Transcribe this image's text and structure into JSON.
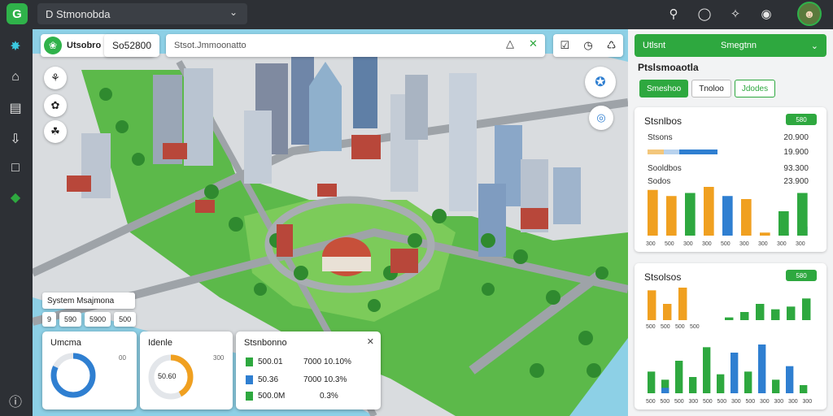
{
  "topbar": {
    "logo": "G",
    "title": "D  Stmonobda",
    "icons": [
      "search-icon",
      "circle-icon",
      "tools-icon",
      "notification-icon"
    ]
  },
  "sidebar": {
    "icons": [
      "network-icon",
      "home-icon",
      "clipboard-icon",
      "download-icon",
      "square-icon",
      "layers-icon",
      "help-icon"
    ]
  },
  "map": {
    "toolbar_label": "Utsobro",
    "score": "So52800",
    "search_placeholder": "Stsot.Jmmoonatto",
    "actions": [
      "clipboard-icon",
      "clock-icon",
      "share-icon"
    ],
    "tools": [
      "bike-icon",
      "tree-icon",
      "plant-icon"
    ],
    "system_label": "System Msajmona",
    "system_chips": [
      "9",
      "590",
      "5900",
      "500"
    ],
    "card1": {
      "title": "Umcma",
      "aside": "00",
      "progress": 0.82
    },
    "card2": {
      "title": "Idenle",
      "aside": "300",
      "center": "50.60",
      "progress": 0.42
    },
    "card3": {
      "title": "Stsnbonno",
      "rows": [
        {
          "color": "#2ea83f",
          "label": "500.01",
          "value": "7000 10.10%"
        },
        {
          "color": "#2f7fd1",
          "label": "50.36",
          "value": "7000 10.3%"
        },
        {
          "color": "#2ea83f",
          "label": "500.0M",
          "value": "0.3%"
        }
      ]
    },
    "colors": {
      "green": "#2ea83f",
      "blue": "#2f7fd1",
      "orange": "#f0a020"
    }
  },
  "right_panel": {
    "header_a": "Utlsnt",
    "header_b": "Smegtnn",
    "subtitle": "Ptslsmoaotla",
    "tabs": [
      "Smeshoo",
      "Tnoloo",
      "Jdodes"
    ],
    "stats1": {
      "title": "Stsnlbos",
      "badge": "580",
      "rows": [
        {
          "label": "Stsons",
          "value": "20.900"
        },
        {
          "label": "",
          "value": "19.900"
        },
        {
          "label": "Sooldbos",
          "value": "93.300"
        },
        {
          "label": "Sodos",
          "value": "23.900"
        }
      ],
      "mini_bars": [
        0.6,
        0.55,
        0.8,
        0.6,
        0.4
      ],
      "legend": [
        "300",
        "500",
        "300",
        "300",
        "500",
        "300",
        "300",
        "300",
        "300"
      ]
    },
    "stats2": {
      "title": "Stsolsos",
      "badge": "580",
      "legend": [
        "500",
        "500",
        "500",
        "500"
      ],
      "legend_bottom": [
        "500",
        "500",
        "500",
        "300",
        "500",
        "500",
        "300",
        "500",
        "300",
        "300",
        "300",
        "300"
      ]
    }
  },
  "chart_data": [
    {
      "type": "bar",
      "categories": [
        "300",
        "500",
        "300",
        "300",
        "500",
        "300",
        "300",
        "300",
        "300"
      ],
      "series": [
        {
          "values": [
            75,
            65,
            0,
            80,
            0,
            60,
            5,
            0,
            0
          ]
        },
        {
          "values": [
            0,
            0,
            0,
            0,
            65,
            0,
            0,
            5,
            15
          ]
        },
        {
          "values": [
            0,
            0,
            70,
            0,
            0,
            0,
            0,
            40,
            70
          ]
        }
      ]
    },
    {
      "type": "bar",
      "categories": [
        "500",
        "500",
        "500",
        "500"
      ],
      "series": [
        {
          "values": [
            55,
            30,
            60,
            0,
            0,
            0,
            0,
            0,
            0,
            0,
            0
          ]
        },
        {
          "values": [
            0,
            0,
            0,
            0,
            0,
            5,
            15,
            30,
            20,
            25,
            40
          ]
        }
      ]
    },
    {
      "type": "bar",
      "categories": [
        "500",
        "500",
        "500",
        "300",
        "500",
        "500",
        "300",
        "500",
        "300",
        "300",
        "300",
        "300"
      ],
      "series": [
        {
          "values": [
            40,
            25,
            60,
            30,
            85,
            35,
            0,
            40,
            0,
            25,
            0,
            15
          ]
        },
        {
          "values": [
            0,
            10,
            0,
            0,
            0,
            0,
            75,
            0,
            90,
            0,
            50,
            0
          ]
        }
      ]
    }
  ]
}
